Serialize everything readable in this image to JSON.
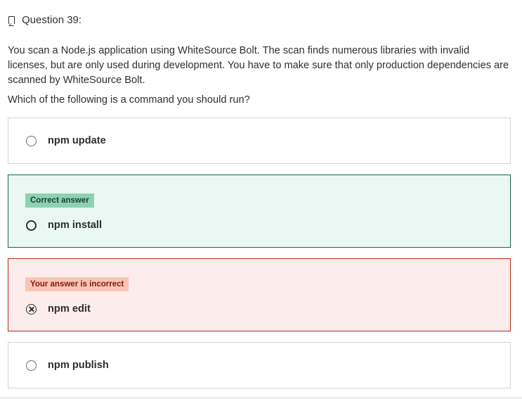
{
  "question": {
    "title": "Question 39:",
    "prompt": "You scan a Node.js application using WhiteSource Bolt. The scan finds numerous libraries with invalid licenses, but are only used during development. You have to make sure that only production dependencies are scanned by WhiteSource Bolt.",
    "ask": "Which of the following is a command you should run?"
  },
  "options": [
    {
      "label": "npm update",
      "state": "neutral"
    },
    {
      "label": "npm install",
      "state": "correct",
      "badge": "Correct answer"
    },
    {
      "label": "npm edit",
      "state": "incorrect-selected",
      "badge": "Your answer is incorrect"
    },
    {
      "label": "npm publish",
      "state": "neutral"
    }
  ],
  "colors": {
    "correct_bg": "#eaf8f3",
    "correct_border": "#1e6055",
    "correct_badge": "#8ed1b1",
    "incorrect_bg": "#fdecec",
    "incorrect_border": "#b32d0f",
    "incorrect_badge": "#fbc4b6"
  },
  "icons": {
    "header": "bookmark-icon",
    "incorrect_marker": "x-circle-icon"
  }
}
